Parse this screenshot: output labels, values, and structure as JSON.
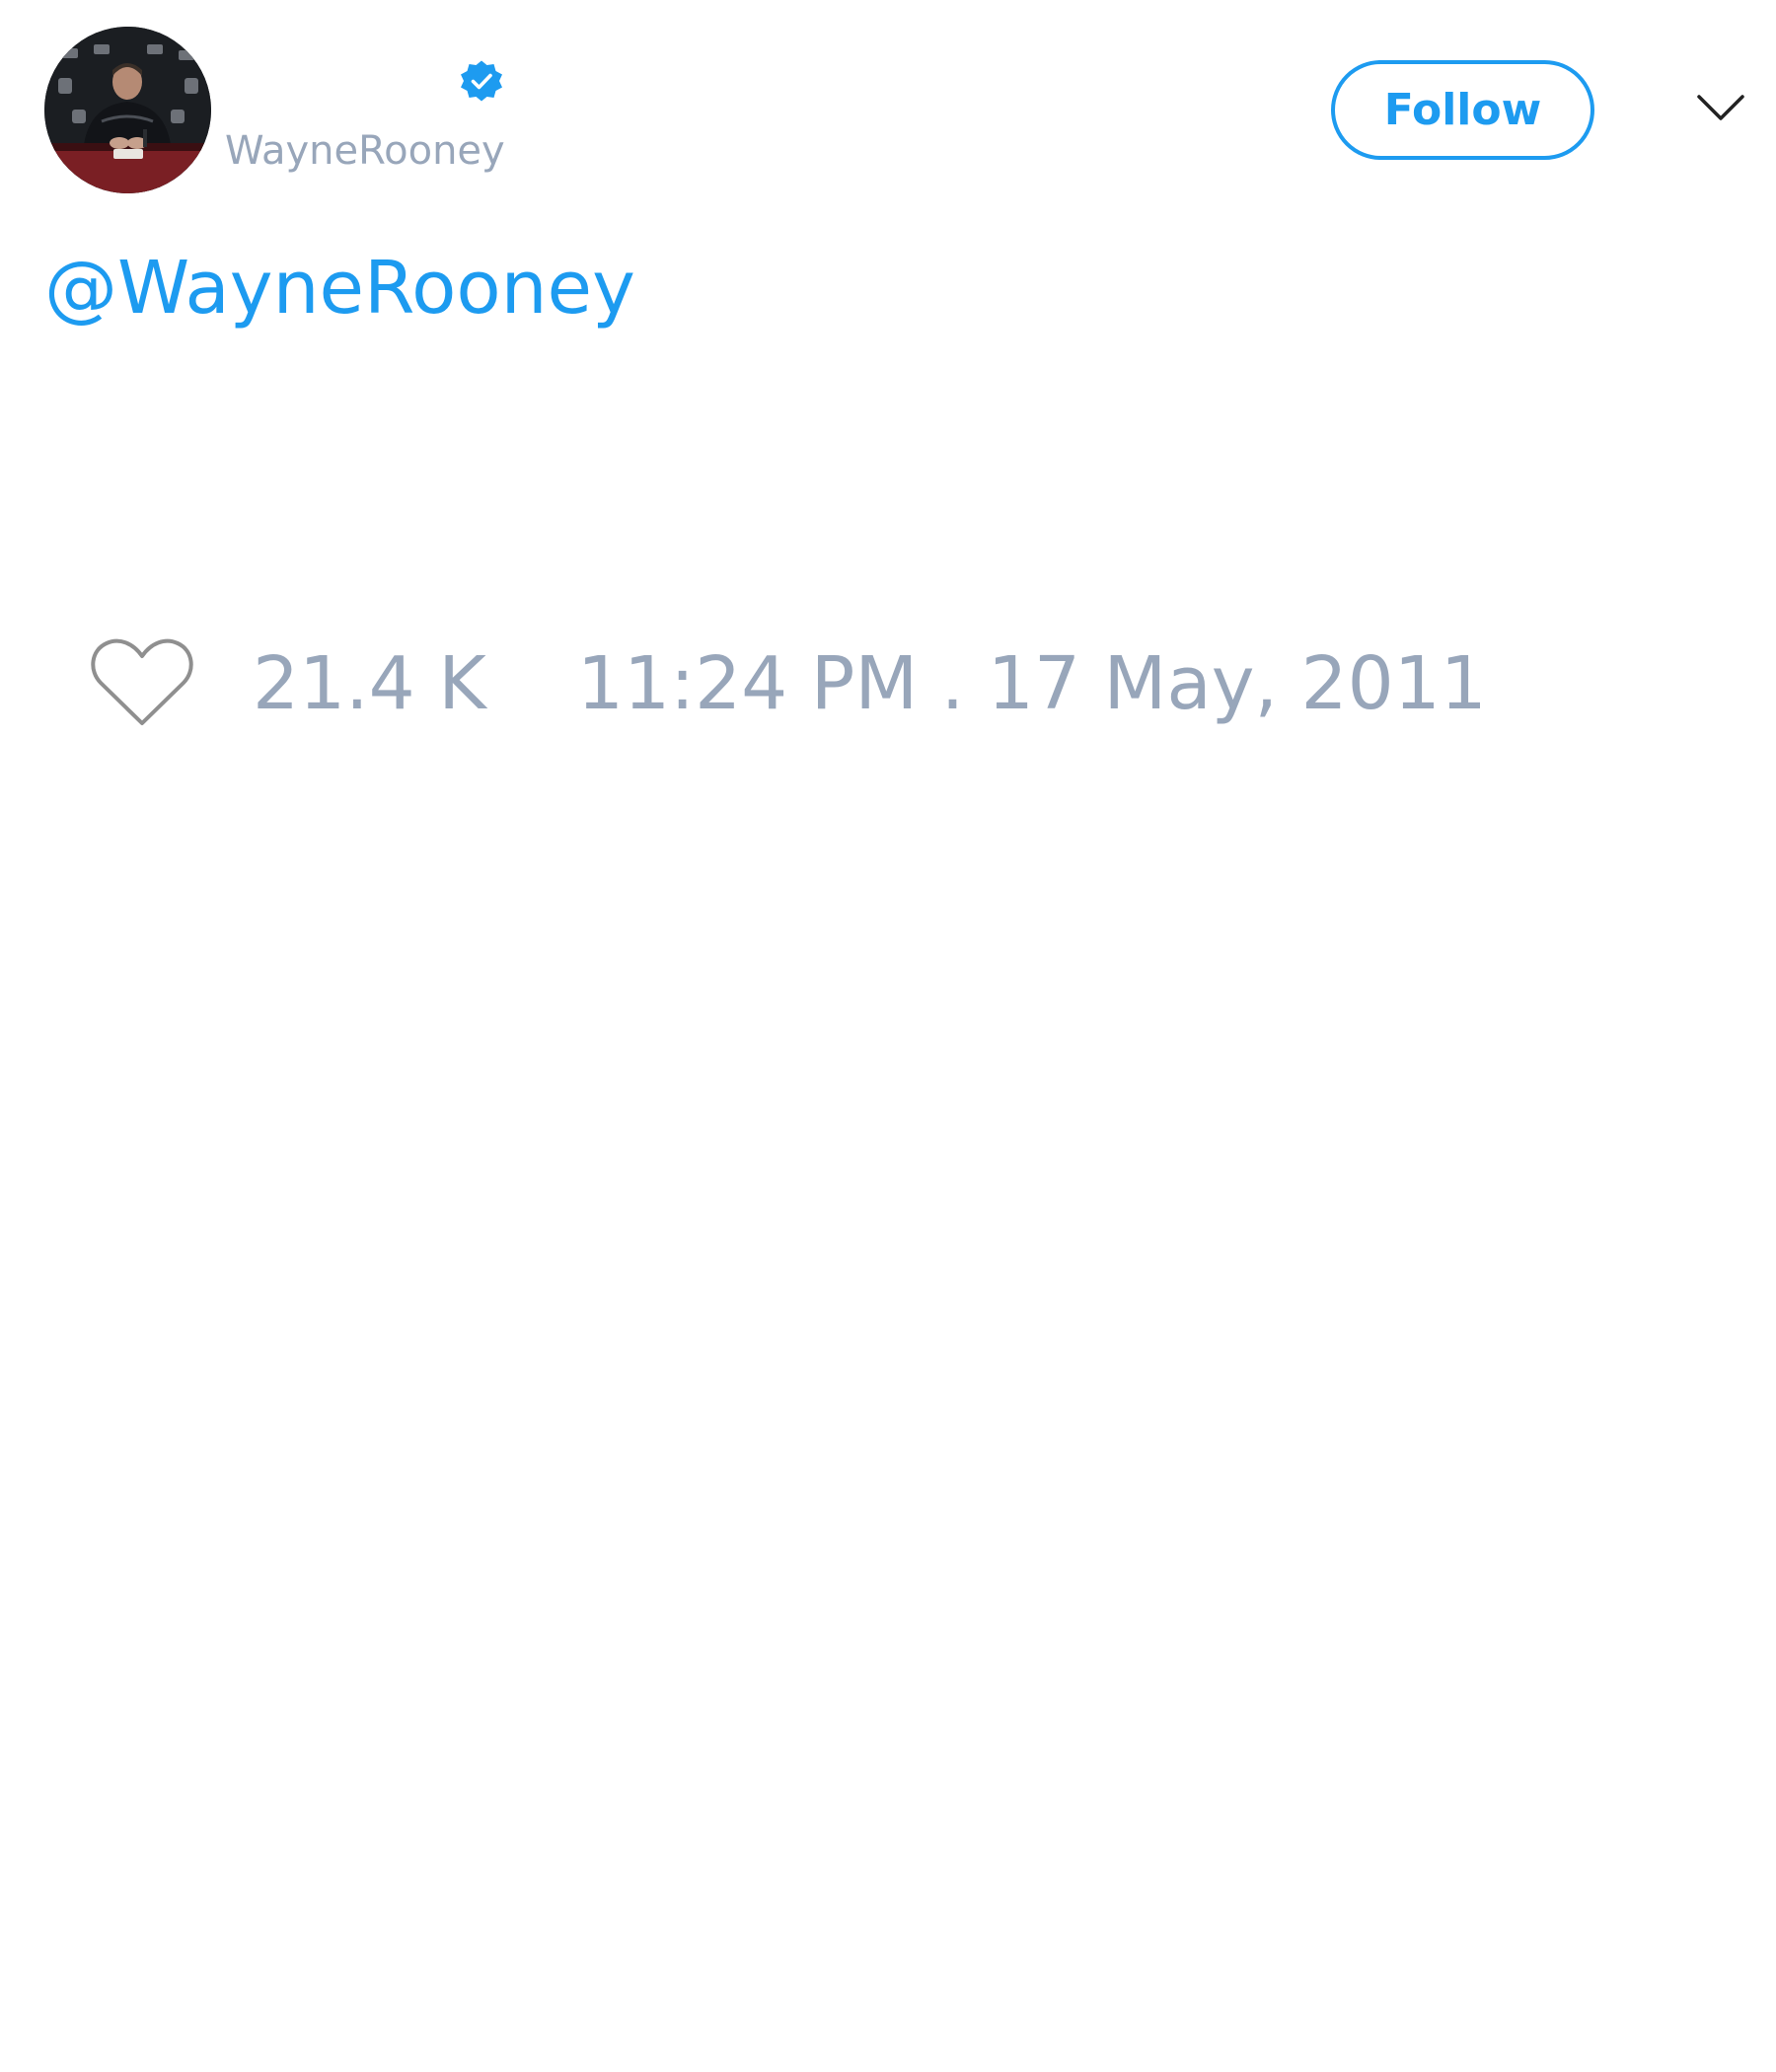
{
  "header": {
    "handle": "WayneRooney",
    "verified": true,
    "follow_label": "Follow"
  },
  "tweet": {
    "mention": "@WayneRooney"
  },
  "footer": {
    "like_count": "21.4 K",
    "timestamp": "11:24 PM . 17 May, 2011"
  },
  "icons": {
    "verified": "verified-badge-icon",
    "menu": "chevron-down-icon",
    "like": "heart-outline-icon"
  },
  "colors": {
    "accent": "#1d9bf0",
    "muted_text": "#98a6ba",
    "icon_gray": "#8f8f8f",
    "background": "#ffffff"
  }
}
